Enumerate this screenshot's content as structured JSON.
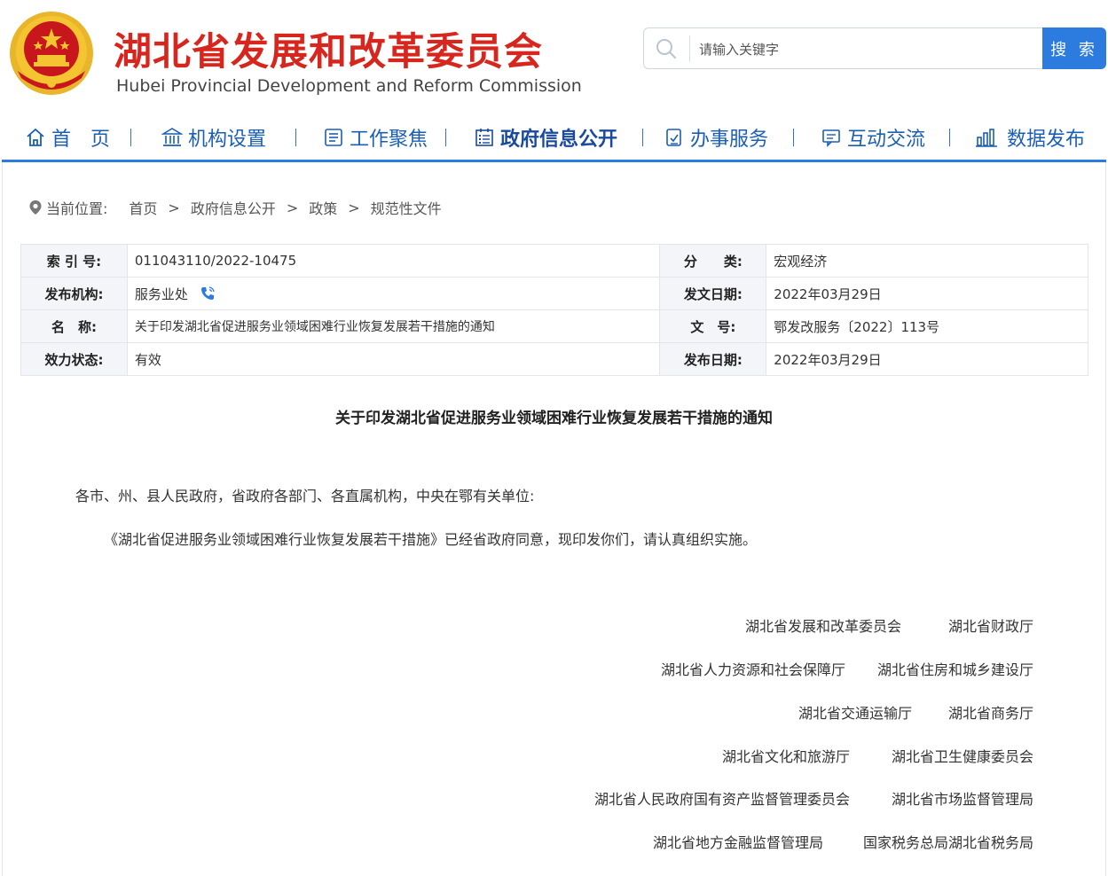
{
  "header": {
    "title_cn": "湖北省发展和改革委员会",
    "title_en": "Hubei Provincial Development and Reform Commission"
  },
  "search": {
    "placeholder": "请输入关键字",
    "button_label": "搜 索"
  },
  "nav": {
    "items": [
      {
        "label": "首　页",
        "icon": "home-icon"
      },
      {
        "label": "机构设置",
        "icon": "institution-icon"
      },
      {
        "label": "工作聚焦",
        "icon": "document-list-icon"
      },
      {
        "label": "政府信息公开",
        "icon": "calendar-list-icon",
        "active": true
      },
      {
        "label": "办事服务",
        "icon": "service-icon"
      },
      {
        "label": "互动交流",
        "icon": "interaction-icon"
      },
      {
        "label": "数据发布",
        "icon": "bar-chart-icon"
      }
    ]
  },
  "breadcrumb": {
    "label": "当前位置:",
    "items": [
      "首页",
      "政府信息公开",
      "政策",
      "规范性文件"
    ],
    "separator": ">"
  },
  "info": {
    "index_label": "索 引 号:",
    "index_value": "011043110/2022-10475",
    "category_label": "分　　类:",
    "category_value": "宏观经济",
    "publisher_label": "发布机构:",
    "publisher_value": "服务业处",
    "issue_date_label": "发文日期:",
    "issue_date_value": "2022年03月29日",
    "name_label": "名　称:",
    "name_value": "关于印发湖北省促进服务业领域困难行业恢复发展若干措施的通知",
    "doc_no_label": "文　号:",
    "doc_no_value": "鄂发改服务〔2022〕113号",
    "status_label": "效力状态:",
    "status_value": "有效",
    "release_date_label": "发布日期:",
    "release_date_value": "2022年03月29日"
  },
  "article": {
    "title": "关于印发湖北省促进服务业领域困难行业恢复发展若干措施的通知",
    "salutation": "各市、州、县人民政府，省政府各部门、各直属机构，中央在鄂有关单位:",
    "body": "《湖北省促进服务业领域困难行业恢复发展若干措施》已经省政府同意，现印发你们，请认真组织实施。",
    "signers": [
      [
        "湖北省发展和改革委员会",
        "湖北省财政厅"
      ],
      [
        "湖北省人力资源和社会保障厅",
        "湖北省住房和城乡建设厅"
      ],
      [
        "湖北省交通运输厅",
        "湖北省商务厅"
      ],
      [
        "湖北省文化和旅游厅",
        "湖北省卫生健康委员会"
      ],
      [
        "湖北省人民政府国有资产监督管理委员会",
        "湖北省市场监督管理局"
      ],
      [
        "湖北省地方金融监督管理局",
        "国家税务总局湖北省税务局"
      ]
    ]
  },
  "colors": {
    "brand_red": "#d7261e",
    "nav_blue": "#1a5fb4",
    "accent_blue": "#2c7cdf",
    "emblem_red": "#c8161d",
    "emblem_gold": "#f4c531"
  }
}
